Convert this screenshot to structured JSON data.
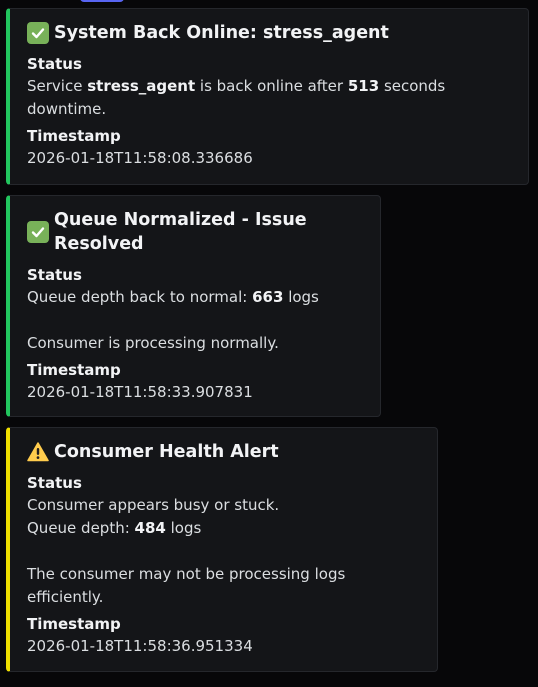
{
  "alerts": [
    {
      "title": "System Back Online: stress_agent",
      "icon": "check-mark-icon",
      "accent": "#22c55e",
      "status_label": "Status",
      "status": {
        "pre": "Service ",
        "service": "stress_agent",
        "mid": " is back online after ",
        "seconds": "513",
        "post": " seconds downtime."
      },
      "timestamp_label": "Timestamp",
      "timestamp": "2026-01-18T11:58:08.336686"
    },
    {
      "title": "Queue Normalized - Issue Resolved",
      "icon": "check-mark-icon",
      "accent": "#22c55e",
      "status_label": "Status",
      "status": {
        "pre": "Queue depth back to normal: ",
        "depth": "663",
        "post": " logs",
        "note": "Consumer is processing normally."
      },
      "timestamp_label": "Timestamp",
      "timestamp": "2026-01-18T11:58:33.907831"
    },
    {
      "title": "Consumer Health Alert",
      "icon": "warning-icon",
      "accent": "#f0e000",
      "status_label": "Status",
      "status": {
        "line1": "Consumer appears busy or stuck.",
        "pre": "Queue depth: ",
        "depth": "484",
        "post": " logs",
        "note": "The consumer may not be processing logs efficiently."
      },
      "timestamp_label": "Timestamp",
      "timestamp": "2026-01-18T11:58:36.951334"
    }
  ]
}
